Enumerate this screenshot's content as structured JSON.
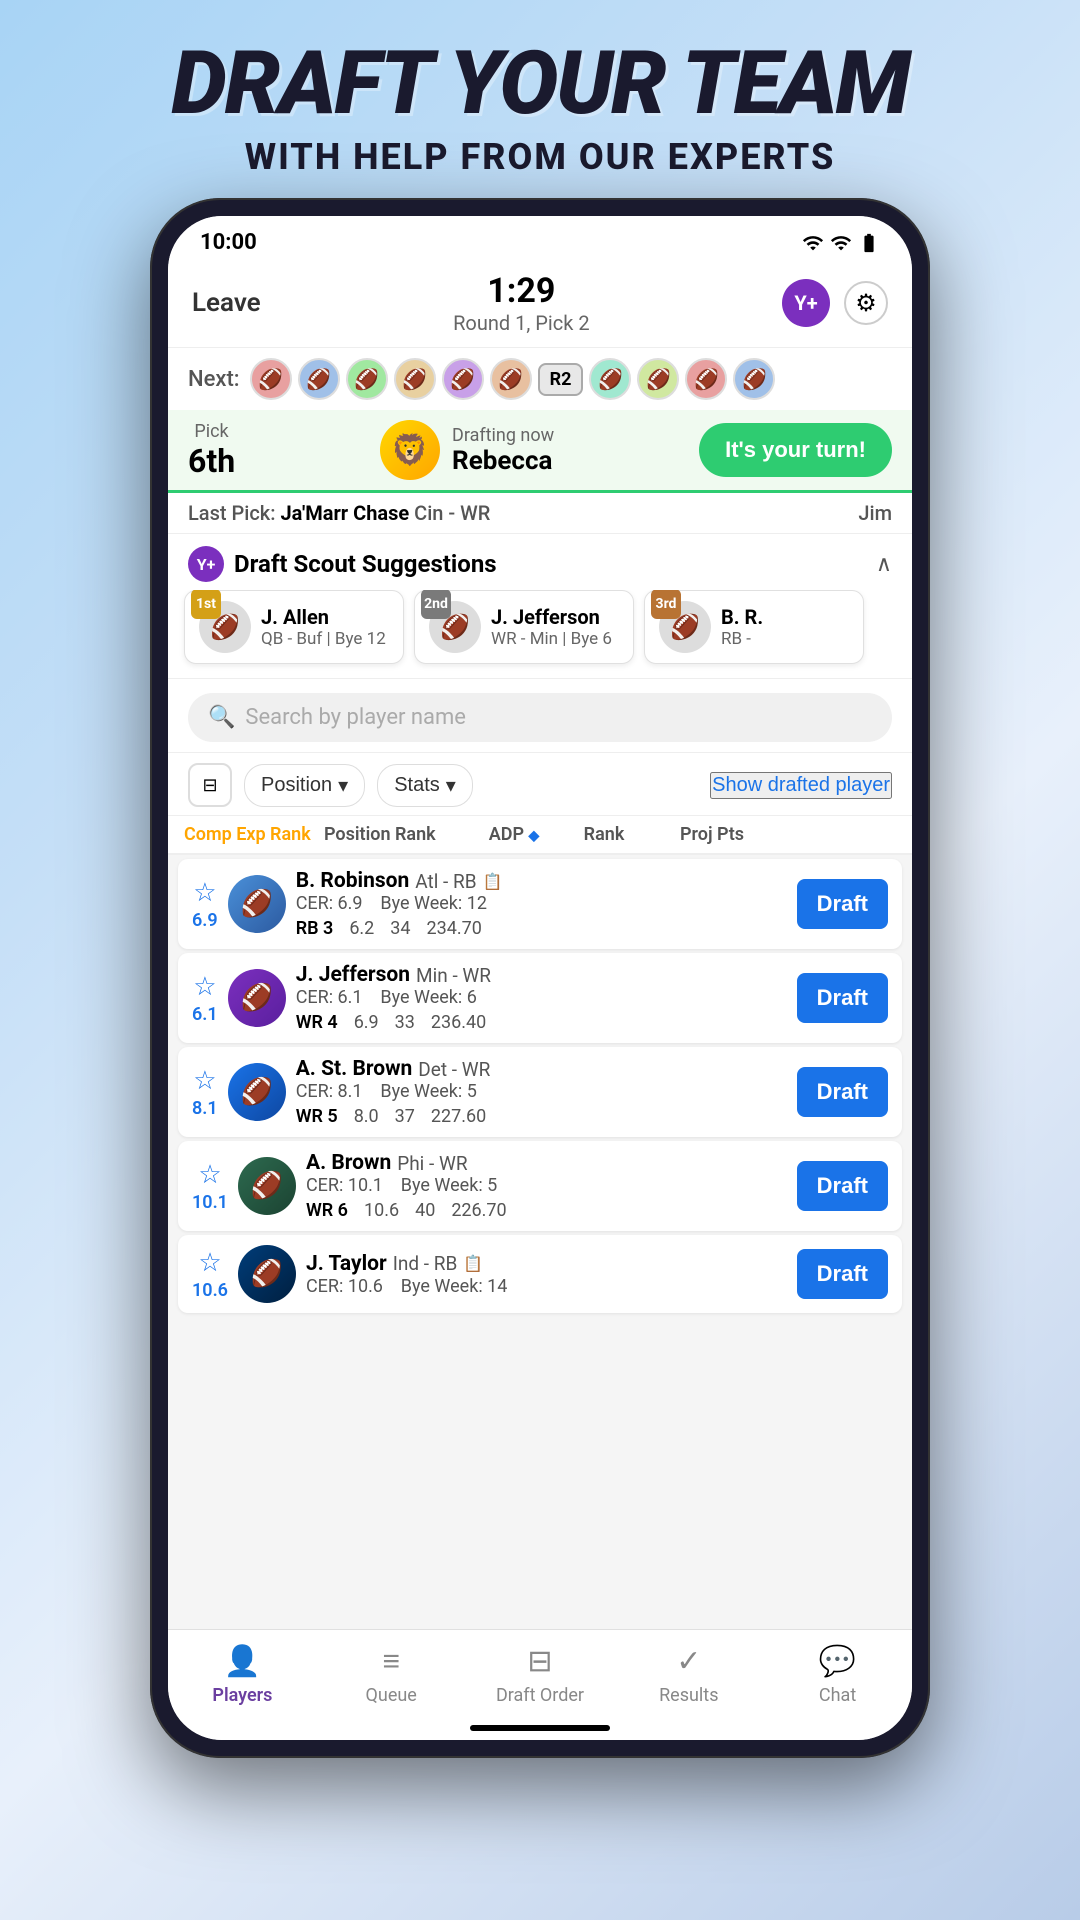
{
  "page": {
    "title": "DRAFT YOUR TEAM",
    "subtitle": "WITH HELP FROM OUR EXPERTS"
  },
  "status_bar": {
    "time": "10:00"
  },
  "header": {
    "leave_label": "Leave",
    "timer": "1:29",
    "round_info": "Round 1, Pick 2",
    "yplus": "Y+",
    "gear": "⚙"
  },
  "next_bar": {
    "label": "Next:",
    "r2": "R2"
  },
  "picking_now": {
    "pick_label": "Pick",
    "pick_number": "6th",
    "drafting_label": "Drafting now",
    "picker_name": "Rebecca",
    "cta": "It's your turn!"
  },
  "last_pick": {
    "label": "Last Pick:",
    "player": "Ja'Marr Chase",
    "team_pos": "Cin - WR",
    "drafter": "Jim"
  },
  "scout": {
    "title": "Draft Scout Suggestions",
    "suggestions": [
      {
        "rank": "1st",
        "name": "J. Allen",
        "pos": "QB - Buf | Bye 12"
      },
      {
        "rank": "2nd",
        "name": "J. Jefferson",
        "pos": "WR - Min | Bye 6"
      },
      {
        "rank": "3rd",
        "name": "B. R.",
        "pos": "RB -"
      }
    ]
  },
  "search": {
    "placeholder": "Search by player name"
  },
  "filters": {
    "position_label": "Position",
    "stats_label": "Stats",
    "show_drafted": "Show drafted player"
  },
  "table_header": {
    "comp_exp": "Comp Exp Rank",
    "position_rank": "Position Rank",
    "adp": "ADP",
    "rank": "Rank",
    "proj_pts": "Proj Pts"
  },
  "players": [
    {
      "cer": "6.9",
      "name": "B. Robinson",
      "team": "Atl - RB",
      "cer_detail": "CER: 6.9",
      "bye": "Bye Week: 12",
      "pos_rank": "RB 3",
      "adp": "6.2",
      "rank": "34",
      "proj_pts": "234.70"
    },
    {
      "cer": "6.1",
      "name": "J. Jefferson",
      "team": "Min - WR",
      "cer_detail": "CER: 6.1",
      "bye": "Bye Week: 6",
      "pos_rank": "WR 4",
      "adp": "6.9",
      "rank": "33",
      "proj_pts": "236.40"
    },
    {
      "cer": "8.1",
      "name": "A. St. Brown",
      "team": "Det - WR",
      "cer_detail": "CER: 8.1",
      "bye": "Bye Week: 5",
      "pos_rank": "WR 5",
      "adp": "8.0",
      "rank": "37",
      "proj_pts": "227.60"
    },
    {
      "cer": "10.1",
      "name": "A. Brown",
      "team": "Phi - WR",
      "cer_detail": "CER: 10.1",
      "bye": "Bye Week: 5",
      "pos_rank": "WR 6",
      "adp": "10.6",
      "rank": "40",
      "proj_pts": "226.70"
    },
    {
      "cer": "10.6",
      "name": "J. Taylor",
      "team": "Ind - RB",
      "cer_detail": "CER: 10.6",
      "bye": "Bye Week: 14",
      "pos_rank": "",
      "adp": "",
      "rank": "",
      "proj_pts": ""
    }
  ],
  "bottom_nav": {
    "items": [
      {
        "id": "players",
        "label": "Players",
        "icon": "👤",
        "active": true
      },
      {
        "id": "queue",
        "label": "Queue",
        "icon": "≡",
        "active": false
      },
      {
        "id": "draft-order",
        "label": "Draft Order",
        "icon": "⊟",
        "active": false
      },
      {
        "id": "results",
        "label": "Results",
        "icon": "✓",
        "active": false
      },
      {
        "id": "chat",
        "label": "Chat",
        "icon": "💬",
        "active": false
      }
    ]
  }
}
